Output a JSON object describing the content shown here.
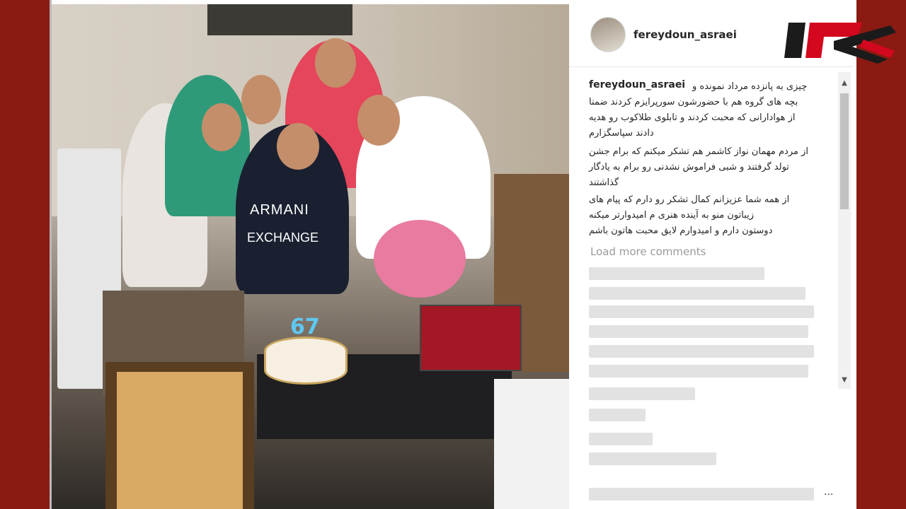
{
  "page": {
    "background_color": "#8a1a12"
  },
  "post": {
    "username": "fereydoun_asraei",
    "caption_username": "fereydoun_asraei",
    "caption_lines": [
      "چیزی به پانزده مرداد نمونده و",
      "بچه های گروه هم با حضورشون سورپرایزم کردند ضمنا",
      "از هوادارانی که محبت کردند و تابلوی طلاکوب رو هدیه",
      "دادند سپاسگزارم",
      "از مردم مهمان نواز کاشمر هم تشکر میکنم که برام جشن",
      "تولد گرفتند و شبی فراموش نشدنی رو برام به یادگار",
      "گذاشتند",
      "از همه شما عزیزانم کمال تشکر رو دارم که پیام های",
      "زیباتون منو به آینده هنری م امیدوارتر میکنه",
      "دوستون دارم و امیدوارم لایق محبت هاتون باشم"
    ],
    "load_more_label": "Load more comments",
    "more_options": "..."
  },
  "photo": {
    "shirt_text_line1": "ARMANI",
    "shirt_text_line2": "EXCHANGE",
    "candle_number": "67"
  },
  "icons": {
    "scroll_up": "▲",
    "scroll_down": "▼"
  },
  "logo": {
    "color": "#d3071e",
    "dark_color": "#1b1b1b"
  }
}
